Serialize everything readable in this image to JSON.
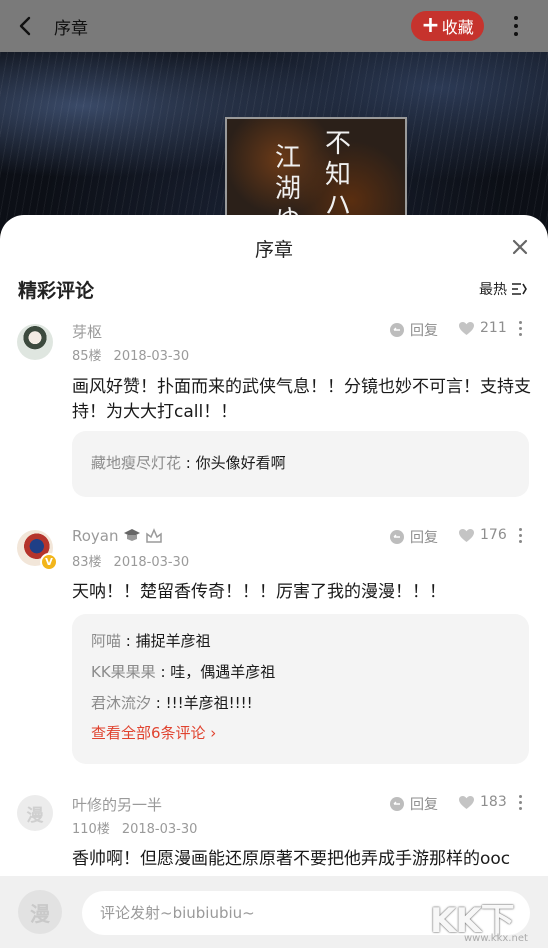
{
  "header": {
    "title": "序章",
    "favorite_label": "收藏",
    "favorite_plus": "+"
  },
  "cover": {
    "col1": [
      "江",
      "湖",
      "ゆ"
    ],
    "col2": [
      "不",
      "知",
      "ハ"
    ]
  },
  "sheet": {
    "title": "序章",
    "section_title": "精彩评论",
    "sort_label": "最热"
  },
  "comments": [
    {
      "username": "芽枢",
      "floor": "85楼",
      "date": "2018-03-30",
      "reply_label": "回复",
      "likes": "211",
      "text": "画风好赞！扑面而来的武侠气息！！分镜也妙不可言！支持支持！为大大打call！！",
      "replies": [
        {
          "name": "藏地瘦尽灯花",
          "text": " : 你头像好看啊"
        }
      ]
    },
    {
      "username": "Royan",
      "floor": "83楼",
      "date": "2018-03-30",
      "reply_label": "回复",
      "likes": "176",
      "text": "天呐！！楚留香传奇！！！厉害了我的漫漫！！！",
      "replies": [
        {
          "name": "阿喵",
          "text": " : 捕捉羊彦祖"
        },
        {
          "name": "KK果果果",
          "text": " : 哇，偶遇羊彦祖"
        },
        {
          "name": "君沐流汐",
          "text": " : !!!羊彦祖!!!!"
        }
      ],
      "view_all": "查看全部6条评论 ›"
    },
    {
      "username": "叶修的另一半",
      "floor": "110楼",
      "date": "2018-03-30",
      "reply_label": "回复",
      "likes": "183",
      "text": "香帅啊！但愿漫画能还原原著不要把他弄成手游那样的ooc"
    }
  ],
  "avatars": {
    "default_glyph": "漫"
  },
  "input": {
    "placeholder": "评论发射~biubiubiu~",
    "value": ""
  },
  "watermark": {
    "text": "KK下载",
    "url": "www.kkx.net"
  },
  "colors": {
    "accent": "#c6332d",
    "link": "#e0432f",
    "topbar": "#7a7a7a"
  }
}
